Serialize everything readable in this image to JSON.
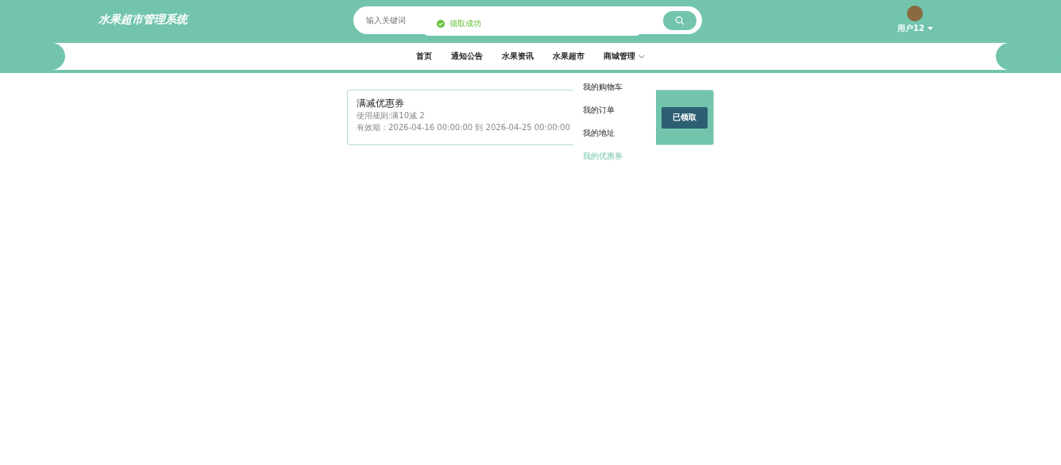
{
  "header": {
    "title": "水果超市管理系统",
    "search": {
      "placeholder": "输入关键词"
    },
    "user": {
      "name": "用户12"
    }
  },
  "toast": {
    "text": "领取成功"
  },
  "nav": {
    "items": [
      {
        "label": "首页",
        "has_menu": false
      },
      {
        "label": "通知公告",
        "has_menu": false
      },
      {
        "label": "水果资讯",
        "has_menu": false
      },
      {
        "label": "水果超市",
        "has_menu": false
      },
      {
        "label": "商城管理",
        "has_menu": true
      }
    ]
  },
  "dropdown": {
    "items": [
      {
        "label": "我的购物车",
        "selected": false
      },
      {
        "label": "我的订单",
        "selected": false
      },
      {
        "label": "我的地址",
        "selected": false
      },
      {
        "label": "我的优惠券",
        "selected": true
      }
    ]
  },
  "coupon": {
    "name": "满减优惠券",
    "rule": "使用规则:满10减 2",
    "validity": "有效期：2026-04-16 00:00:00 到 2026-04-25 00:00:00",
    "button": "已领取"
  }
}
